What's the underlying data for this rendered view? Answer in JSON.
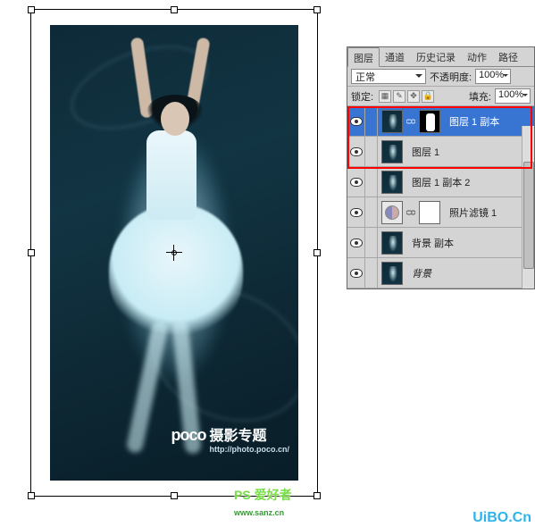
{
  "canvas": {
    "watermark_brand": "poco",
    "watermark_text": "摄影专题",
    "watermark_url": "http://photo.poco.cn/",
    "watermark_site": "UiBO.Cn",
    "watermark_ps": "PS 爱好者",
    "watermark_ps_url": "www.sanz.cn"
  },
  "panel": {
    "tabs": [
      "图层",
      "通道",
      "历史记录",
      "动作",
      "路径"
    ],
    "active_tab": "图层",
    "blend_mode": "正常",
    "opacity_label": "不透明度:",
    "opacity_value": "100%",
    "lock_label": "锁定:",
    "fill_label": "填充:",
    "fill_value": "100%"
  },
  "layers": [
    {
      "name": "图层 1 副本",
      "selected": true,
      "hasMask": true,
      "visible": true
    },
    {
      "name": "图层 1",
      "selected": false,
      "hasMask": false,
      "visible": true
    },
    {
      "name": "图层 1 副本 2",
      "selected": false,
      "hasMask": false,
      "visible": true
    },
    {
      "name": "照片滤镜 1",
      "selected": false,
      "adjustment": true,
      "hasMask": true,
      "visible": true
    },
    {
      "name": "背景 副本",
      "selected": false,
      "hasMask": false,
      "visible": true
    },
    {
      "name": "背景",
      "selected": false,
      "hasMask": false,
      "visible": true,
      "italic": true
    }
  ]
}
